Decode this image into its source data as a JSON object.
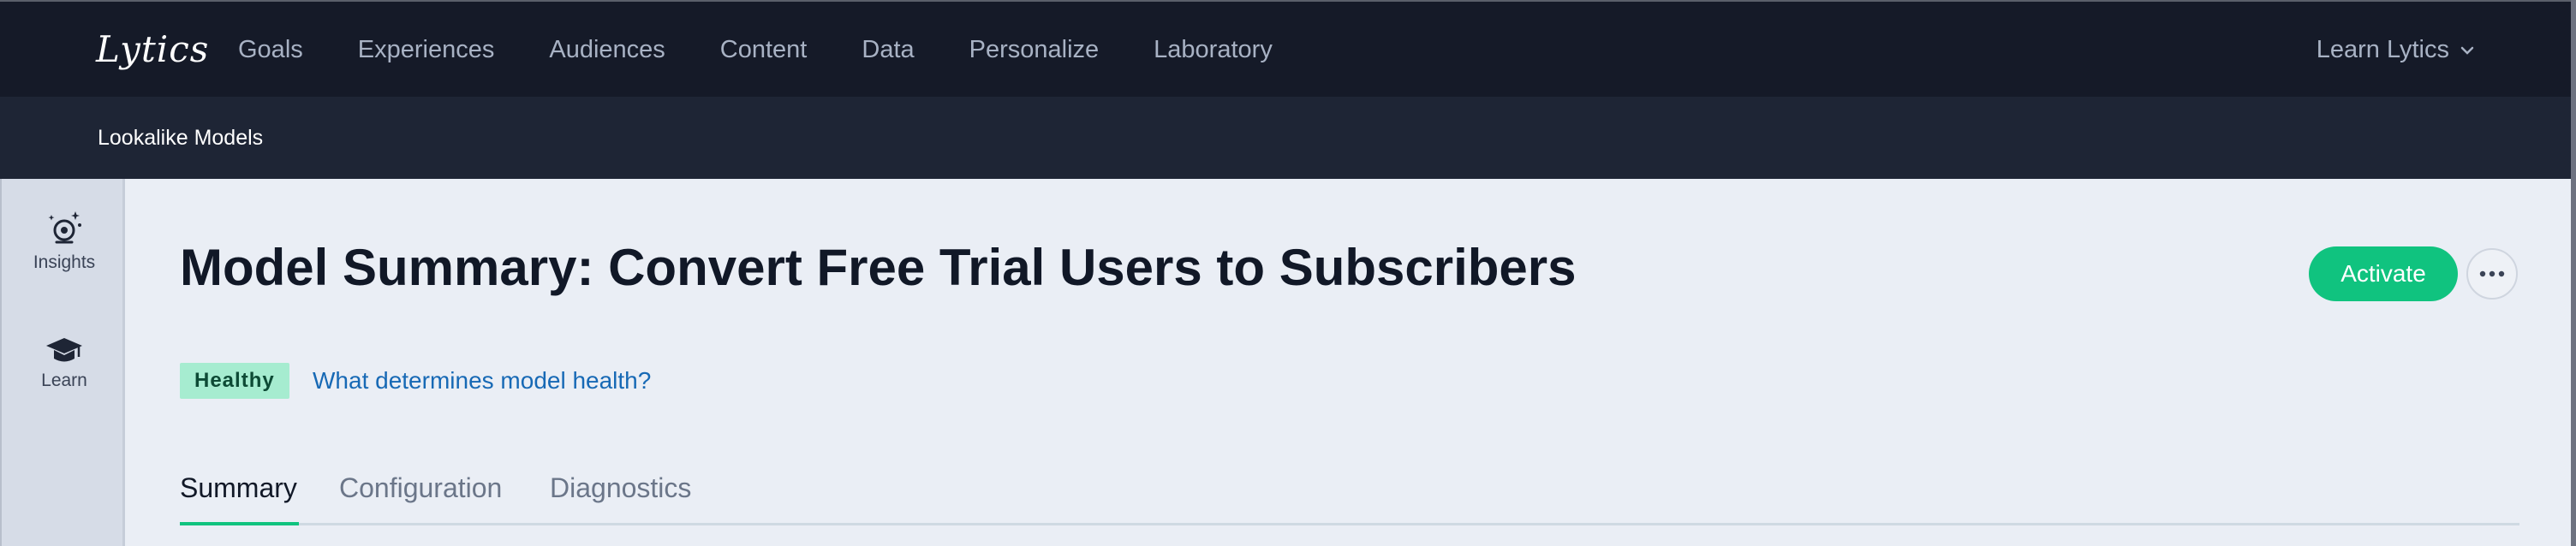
{
  "brand": {
    "logo_text": "Lytics"
  },
  "topnav": {
    "items": [
      "Goals",
      "Experiences",
      "Audiences",
      "Content",
      "Data",
      "Personalize",
      "Laboratory"
    ],
    "account_label": "Learn Lytics"
  },
  "subnav": {
    "title": "Lookalike Models"
  },
  "sidebar": {
    "items": [
      {
        "label": "Insights",
        "icon": "insights-icon"
      },
      {
        "label": "Learn",
        "icon": "graduation-cap-icon"
      }
    ]
  },
  "main": {
    "title": "Model Summary: Convert Free Trial Users to Subscribers",
    "activate_label": "Activate",
    "more_icon": "ellipsis-icon",
    "status_badge": "Healthy",
    "health_link": "What determines model health?",
    "tabs": [
      {
        "label": "Summary",
        "active": true
      },
      {
        "label": "Configuration",
        "active": false
      },
      {
        "label": "Diagnostics",
        "active": false
      }
    ]
  },
  "colors": {
    "nav_bg": "#151a28",
    "subnav_bg": "#1e2535",
    "accent_green": "#10c37f",
    "badge_bg": "#a6ecd0",
    "link_blue": "#1769b5",
    "page_bg": "#eaeef5"
  }
}
